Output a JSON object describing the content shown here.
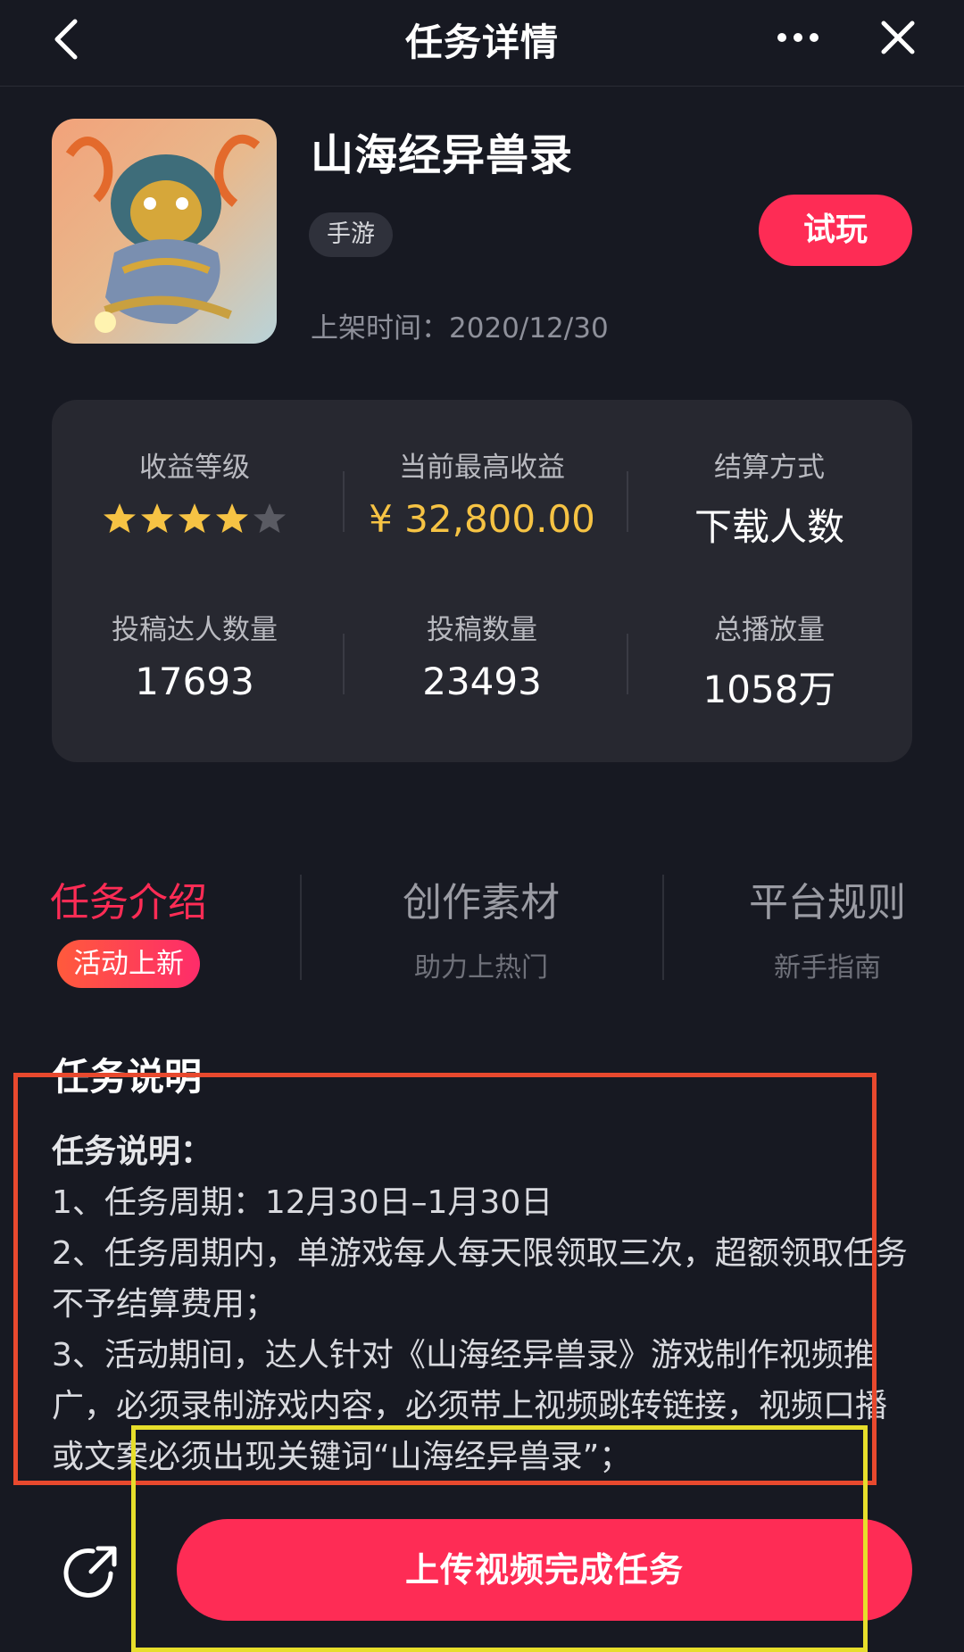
{
  "nav": {
    "title": "任务详情"
  },
  "app": {
    "name": "山海经异兽录",
    "tag": "手游",
    "release_label": "上架时间：",
    "release_date": "2020/12/30",
    "try_button": "试玩"
  },
  "stats": {
    "revenue_level": {
      "label": "收益等级",
      "stars_filled": 4,
      "stars_total": 5
    },
    "max_revenue": {
      "label": "当前最高收益",
      "value": "¥ 32,800.00"
    },
    "settlement": {
      "label": "结算方式",
      "value": "下载人数"
    },
    "creators": {
      "label": "投稿达人数量",
      "value": "17693"
    },
    "submissions": {
      "label": "投稿数量",
      "value": "23493"
    },
    "plays": {
      "label": "总播放量",
      "value": "1058万"
    }
  },
  "tabs": [
    {
      "title": "任务介绍",
      "sub": "活动上新"
    },
    {
      "title": "创作素材",
      "sub": "助力上热门"
    },
    {
      "title": "平台规则",
      "sub": "新手指南"
    }
  ],
  "description": {
    "section_title": "任务说明",
    "heading": "任务说明：",
    "items": [
      "1、任务周期：12月30日–1月30日",
      "2、任务周期内，单游戏每人每天限领取三次，超额领取任务不予结算费用；",
      "3、活动期间，达人针对《山海经异兽录》游戏制作视频推广，必须录制游戏内容，必须带上视频跳转链接，视频口播或文案必须出现关键词“山海经异兽录”；"
    ]
  },
  "bottom": {
    "upload_button": "上传视频完成任务"
  },
  "colors": {
    "accent": "#fe2c55",
    "gold": "#f6c344",
    "background": "#171922",
    "card": "#272830",
    "annotation_red": "#e8492e",
    "annotation_yellow": "#e7de2b"
  }
}
